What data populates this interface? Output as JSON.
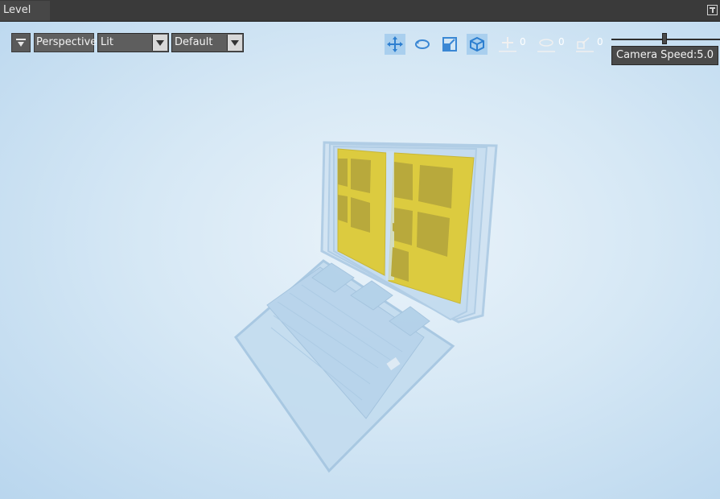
{
  "tab": {
    "title": "Level"
  },
  "toolbar": {
    "view_mode": "Perspective",
    "lighting_mode": "Lit",
    "preset": "Default",
    "move_snap_value": "0",
    "rotate_snap_value": "0",
    "scale_snap_value": "0",
    "camera_speed_label": "Camera Speed:5.0"
  },
  "colors": {
    "viewport_bg": "#d6e8f5",
    "accent_active": "#a9cfee",
    "screen_yellow": "#e3cc3b"
  },
  "icons": [
    "viewport-options-icon",
    "move-tool-icon",
    "rotate-tool-icon",
    "scale-tool-icon",
    "world-local-icon",
    "move-snap-icon",
    "rotate-snap-icon",
    "scale-snap-icon",
    "maximize-icon"
  ]
}
